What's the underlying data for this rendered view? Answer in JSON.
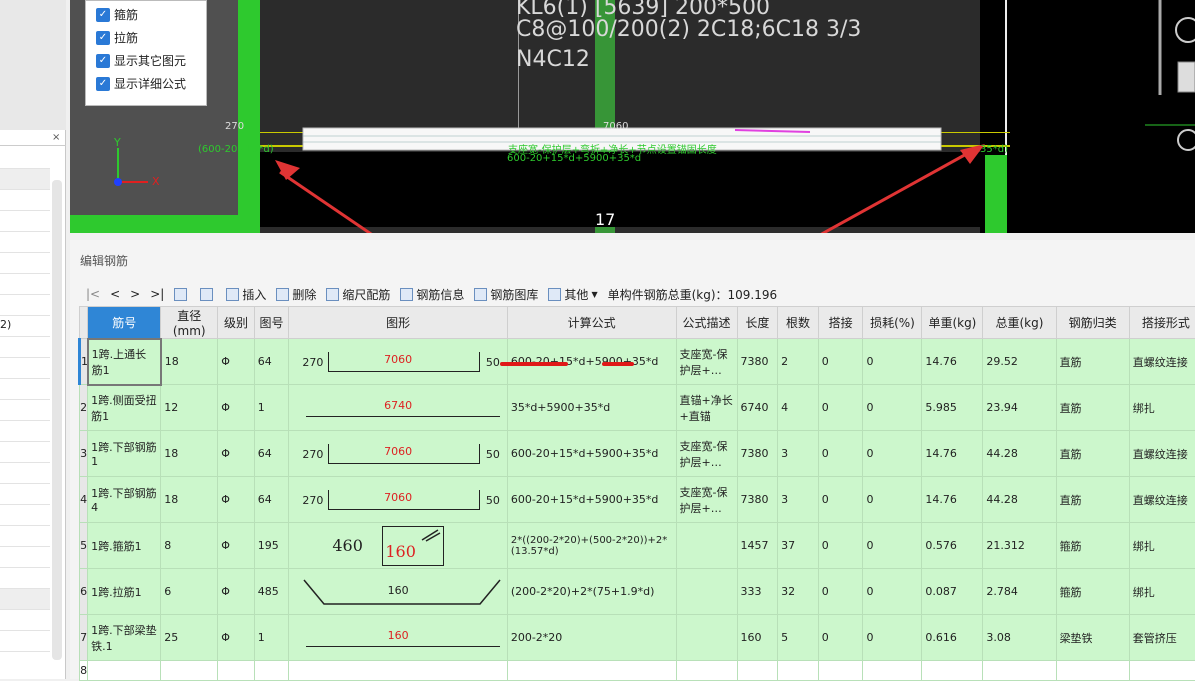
{
  "options": {
    "items": [
      {
        "label": "箍筋"
      },
      {
        "label": "拉筋"
      },
      {
        "label": "显示其它图元"
      },
      {
        "label": "显示详细公式"
      }
    ]
  },
  "viewport": {
    "cad_line1": "KL6(1) [5639] 200*500",
    "cad_line2": "C8@100/200(2) 2C18;6C18 3/3",
    "cad_line3": "N4C12",
    "dim_left": "270",
    "dim_mid": "7060",
    "formula_left": "(600-20+15*d)",
    "formula_mid1": "支座宽-保护层+弯折+净长+节点设置锚固长度",
    "formula_mid2": "600-20+15*d+5900+35*d",
    "formula_right": "35*d)",
    "axis_num": "17",
    "axis_y": "Y",
    "axis_x": "X"
  },
  "left_panel": {
    "row_label": "2)",
    "close": "×"
  },
  "editor": {
    "title": "编辑钢筋",
    "toolbar": {
      "nav_first": "|<",
      "nav_prev": "<",
      "nav_next": ">",
      "nav_last": ">|",
      "insert": "插入",
      "delete": "删除",
      "scale": "缩尺配筋",
      "info": "钢筋信息",
      "library": "钢筋图库",
      "other": "其他",
      "total": "单构件钢筋总重(kg)：109.196"
    },
    "headers": [
      "筋号",
      "直径(mm)",
      "级别",
      "图号",
      "图形",
      "计算公式",
      "公式描述",
      "长度",
      "根数",
      "搭接",
      "损耗(%)",
      "单重(kg)",
      "总重(kg)",
      "钢筋归类",
      "搭接形式"
    ],
    "rows": [
      {
        "no": "1",
        "name": "1跨.上通长筋1",
        "dia": "18",
        "grade": "Φ",
        "fig": "64",
        "sl": "270",
        "sm": "7060",
        "sr": "50",
        "formula": "600-20+15*d+5900+35*d",
        "desc": "支座宽-保护层+…",
        "len": "7380",
        "count": "2",
        "lap": "0",
        "loss": "0",
        "uw": "14.76",
        "tw": "29.52",
        "cat": "直筋",
        "lapt": "直螺纹连接",
        "type": "hook"
      },
      {
        "no": "2",
        "name": "1跨.侧面受扭筋1",
        "dia": "12",
        "grade": "Φ",
        "fig": "1",
        "sl": "",
        "sm": "6740",
        "sr": "",
        "formula": "35*d+5900+35*d",
        "desc": "直锚+净长+直锚",
        "len": "6740",
        "count": "4",
        "lap": "0",
        "loss": "0",
        "uw": "5.985",
        "tw": "23.94",
        "cat": "直筋",
        "lapt": "绑扎",
        "type": "flat"
      },
      {
        "no": "3",
        "name": "1跨.下部钢筋1",
        "dia": "18",
        "grade": "Φ",
        "fig": "64",
        "sl": "270",
        "sm": "7060",
        "sr": "50",
        "formula": "600-20+15*d+5900+35*d",
        "desc": "支座宽-保护层+…",
        "len": "7380",
        "count": "3",
        "lap": "0",
        "loss": "0",
        "uw": "14.76",
        "tw": "44.28",
        "cat": "直筋",
        "lapt": "直螺纹连接",
        "type": "hook"
      },
      {
        "no": "4",
        "name": "1跨.下部钢筋4",
        "dia": "18",
        "grade": "Φ",
        "fig": "64",
        "sl": "270",
        "sm": "7060",
        "sr": "50",
        "formula": "600-20+15*d+5900+35*d",
        "desc": "支座宽-保护层+…",
        "len": "7380",
        "count": "3",
        "lap": "0",
        "loss": "0",
        "uw": "14.76",
        "tw": "44.28",
        "cat": "直筋",
        "lapt": "直螺纹连接",
        "type": "hook"
      },
      {
        "no": "5",
        "name": "1跨.箍筋1",
        "dia": "8",
        "grade": "Φ",
        "fig": "195",
        "sl": "460",
        "sm": "160",
        "sr": "",
        "formula": "2*((200-2*20)+(500-2*20))+2*(13.57*d)",
        "desc": "",
        "len": "1457",
        "count": "37",
        "lap": "0",
        "loss": "0",
        "uw": "0.576",
        "tw": "21.312",
        "cat": "箍筋",
        "lapt": "绑扎",
        "type": "stirrup"
      },
      {
        "no": "6",
        "name": "1跨.拉筋1",
        "dia": "6",
        "grade": "Φ",
        "fig": "485",
        "sl": "",
        "sm": "160",
        "sr": "",
        "formula": "(200-2*20)+2*(75+1.9*d)",
        "desc": "",
        "len": "333",
        "count": "32",
        "lap": "0",
        "loss": "0",
        "uw": "0.087",
        "tw": "2.784",
        "cat": "箍筋",
        "lapt": "绑扎",
        "type": "tie"
      },
      {
        "no": "7",
        "name": "1跨.下部梁垫铁.1",
        "dia": "25",
        "grade": "Φ",
        "fig": "1",
        "sl": "",
        "sm": "160",
        "sr": "",
        "formula": "200-2*20",
        "desc": "",
        "len": "160",
        "count": "5",
        "lap": "0",
        "loss": "0",
        "uw": "0.616",
        "tw": "3.08",
        "cat": "梁垫铁",
        "lapt": "套管挤压",
        "type": "flat"
      }
    ],
    "empty_row_no": "8"
  }
}
